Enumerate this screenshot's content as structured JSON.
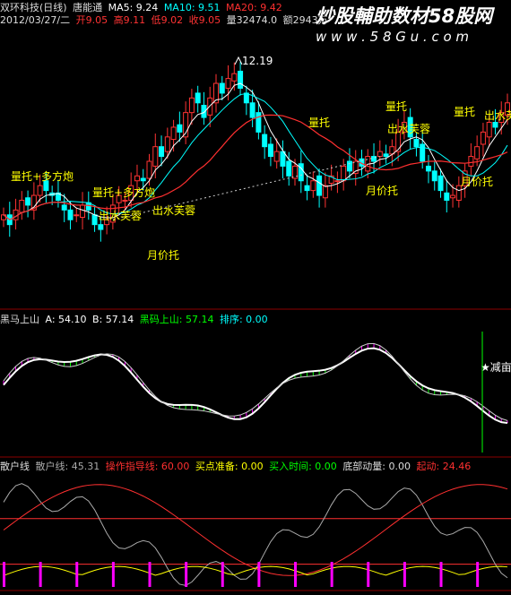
{
  "header1": {
    "title": "双环科技(日线)",
    "mode": "唐能通",
    "ma5": "MA5: 9.24",
    "ma10": "MA10: 9.51",
    "ma20": "MA20: 9.42"
  },
  "header2": {
    "date": "2012/03/27/二",
    "open": "开9.05",
    "high": "高9.11",
    "low": "低9.02",
    "close": "收9.05",
    "vol": "量32474.0",
    "amt": "额2943万"
  },
  "watermark": {
    "text": "炒股輔助数材58股网",
    "url": "w w w . 5 8 G u . c o m"
  },
  "panel2": {
    "name": "黑马上山",
    "a": "A: 54.10",
    "b": "B: 57.14",
    "heima": "黑码上山: 57.14",
    "rank": "排序: 0.00"
  },
  "panel3": {
    "name": "散户线",
    "shx": "散户线: 45.31",
    "czzd": "操作指导线: 60.00",
    "mdzb": "买点准备: 0.00",
    "mrsj": "买入时间: 0.00",
    "dbdl": "底部动量: 0.00",
    "qd": "起动: 24.46"
  },
  "colors": {
    "up": "#ff3333",
    "down": "#00ffff",
    "ma5": "#ffffff",
    "ma10": "#00ffff",
    "ma20": "#ff3030",
    "label": "#ffff00",
    "green": "#00ff00",
    "magenta": "#ff00ff"
  },
  "chart_data": {
    "type": "line",
    "annotations": [
      {
        "text": "12.19"
      },
      {
        "text": "量托+多方炮"
      },
      {
        "text": "量托+多方炮"
      },
      {
        "text": "出水芙蓉"
      },
      {
        "text": "出水芙蓉"
      },
      {
        "text": "月价托"
      },
      {
        "text": "量托"
      },
      {
        "text": "月价托"
      },
      {
        "text": "量托"
      },
      {
        "text": "出水芙蓉"
      },
      {
        "text": "量托"
      },
      {
        "text": "月价托"
      },
      {
        "text": "出水芙"
      },
      {
        "text": "★减亩"
      }
    ],
    "close": [
      9.2,
      9.0,
      9.3,
      9.5,
      9.4,
      9.6,
      9.8,
      9.7,
      9.6,
      9.5,
      9.3,
      9.1,
      9.2,
      9.4,
      9.3,
      9.0,
      8.9,
      9.1,
      9.4,
      9.6,
      9.5,
      9.8,
      10.0,
      9.9,
      10.3,
      10.6,
      10.4,
      10.8,
      11.0,
      10.9,
      11.3,
      11.6,
      11.5,
      11.2,
      11.6,
      11.9,
      11.7,
      12.0,
      12.1,
      11.8,
      11.5,
      11.2,
      10.9,
      10.6,
      10.4,
      10.5,
      10.2,
      10.0,
      10.2,
      9.9,
      9.7,
      9.9,
      9.6,
      9.8,
      10.0,
      9.9,
      10.2,
      10.1,
      10.3,
      10.2,
      10.4,
      10.3,
      10.5,
      10.4,
      10.6,
      10.9,
      11.1,
      10.8,
      10.6,
      10.3,
      10.1,
      9.9,
      9.7,
      9.5,
      9.6,
      9.8,
      10.1,
      10.4,
      10.6,
      10.9,
      11.1,
      11.0,
      11.3,
      11.5
    ],
    "panel2_ylim": [
      0,
      100
    ],
    "panel3_ylim": [
      0,
      100
    ]
  }
}
